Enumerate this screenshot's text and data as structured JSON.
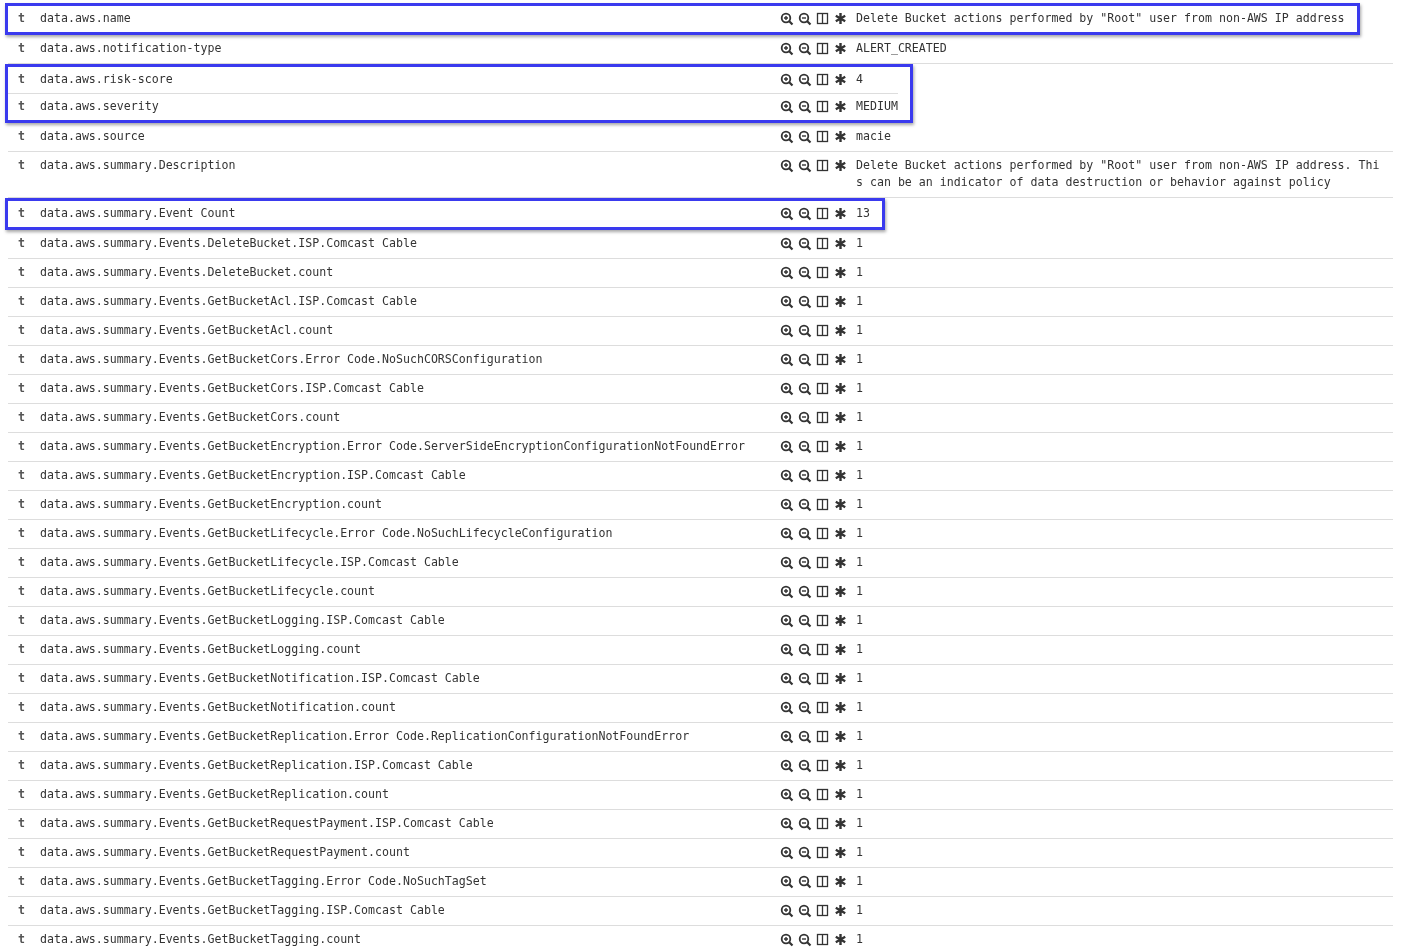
{
  "rows": [
    {
      "type": "t",
      "field": "data.aws.name",
      "value": "Delete Bucket actions performed by \"Root\" user from non-AWS IP address",
      "highlighted": true
    },
    {
      "type": "t",
      "field": "data.aws.notification-type",
      "value": "ALERT_CREATED",
      "highlighted": false
    },
    {
      "type": "t",
      "field": "data.aws.risk-score",
      "value": "4",
      "highlighted": true
    },
    {
      "type": "t",
      "field": "data.aws.severity",
      "value": "MEDIUM",
      "highlighted": true
    },
    {
      "type": "t",
      "field": "data.aws.source",
      "value": "macie",
      "highlighted": false
    },
    {
      "type": "t",
      "field": "data.aws.summary.Description",
      "value": "Delete Bucket actions performed by \"Root\" user from non-AWS IP address. This can be an indicator of data destruction or behavior against policy",
      "highlighted": false
    },
    {
      "type": "t",
      "field": "data.aws.summary.Event Count",
      "value": "13",
      "highlighted": true
    },
    {
      "type": "t",
      "field": "data.aws.summary.Events.DeleteBucket.ISP.Comcast Cable",
      "value": "1",
      "highlighted": false
    },
    {
      "type": "t",
      "field": "data.aws.summary.Events.DeleteBucket.count",
      "value": "1",
      "highlighted": false
    },
    {
      "type": "t",
      "field": "data.aws.summary.Events.GetBucketAcl.ISP.Comcast Cable",
      "value": "1",
      "highlighted": false
    },
    {
      "type": "t",
      "field": "data.aws.summary.Events.GetBucketAcl.count",
      "value": "1",
      "highlighted": false
    },
    {
      "type": "t",
      "field": "data.aws.summary.Events.GetBucketCors.Error Code.NoSuchCORSConfiguration",
      "value": "1",
      "highlighted": false
    },
    {
      "type": "t",
      "field": "data.aws.summary.Events.GetBucketCors.ISP.Comcast Cable",
      "value": "1",
      "highlighted": false
    },
    {
      "type": "t",
      "field": "data.aws.summary.Events.GetBucketCors.count",
      "value": "1",
      "highlighted": false
    },
    {
      "type": "t",
      "field": "data.aws.summary.Events.GetBucketEncryption.Error Code.ServerSideEncryptionConfigurationNotFoundError",
      "value": "1",
      "highlighted": false
    },
    {
      "type": "t",
      "field": "data.aws.summary.Events.GetBucketEncryption.ISP.Comcast Cable",
      "value": "1",
      "highlighted": false
    },
    {
      "type": "t",
      "field": "data.aws.summary.Events.GetBucketEncryption.count",
      "value": "1",
      "highlighted": false
    },
    {
      "type": "t",
      "field": "data.aws.summary.Events.GetBucketLifecycle.Error Code.NoSuchLifecycleConfiguration",
      "value": "1",
      "highlighted": false
    },
    {
      "type": "t",
      "field": "data.aws.summary.Events.GetBucketLifecycle.ISP.Comcast Cable",
      "value": "1",
      "highlighted": false
    },
    {
      "type": "t",
      "field": "data.aws.summary.Events.GetBucketLifecycle.count",
      "value": "1",
      "highlighted": false
    },
    {
      "type": "t",
      "field": "data.aws.summary.Events.GetBucketLogging.ISP.Comcast Cable",
      "value": "1",
      "highlighted": false
    },
    {
      "type": "t",
      "field": "data.aws.summary.Events.GetBucketLogging.count",
      "value": "1",
      "highlighted": false
    },
    {
      "type": "t",
      "field": "data.aws.summary.Events.GetBucketNotification.ISP.Comcast Cable",
      "value": "1",
      "highlighted": false
    },
    {
      "type": "t",
      "field": "data.aws.summary.Events.GetBucketNotification.count",
      "value": "1",
      "highlighted": false
    },
    {
      "type": "t",
      "field": "data.aws.summary.Events.GetBucketReplication.Error Code.ReplicationConfigurationNotFoundError",
      "value": "1",
      "highlighted": false
    },
    {
      "type": "t",
      "field": "data.aws.summary.Events.GetBucketReplication.ISP.Comcast Cable",
      "value": "1",
      "highlighted": false
    },
    {
      "type": "t",
      "field": "data.aws.summary.Events.GetBucketReplication.count",
      "value": "1",
      "highlighted": false
    },
    {
      "type": "t",
      "field": "data.aws.summary.Events.GetBucketRequestPayment.ISP.Comcast Cable",
      "value": "1",
      "highlighted": false
    },
    {
      "type": "t",
      "field": "data.aws.summary.Events.GetBucketRequestPayment.count",
      "value": "1",
      "highlighted": false
    },
    {
      "type": "t",
      "field": "data.aws.summary.Events.GetBucketTagging.Error Code.NoSuchTagSet",
      "value": "1",
      "highlighted": false
    },
    {
      "type": "t",
      "field": "data.aws.summary.Events.GetBucketTagging.ISP.Comcast Cable",
      "value": "1",
      "highlighted": false
    },
    {
      "type": "t",
      "field": "data.aws.summary.Events.GetBucketTagging.count",
      "value": "1",
      "highlighted": false
    }
  ]
}
